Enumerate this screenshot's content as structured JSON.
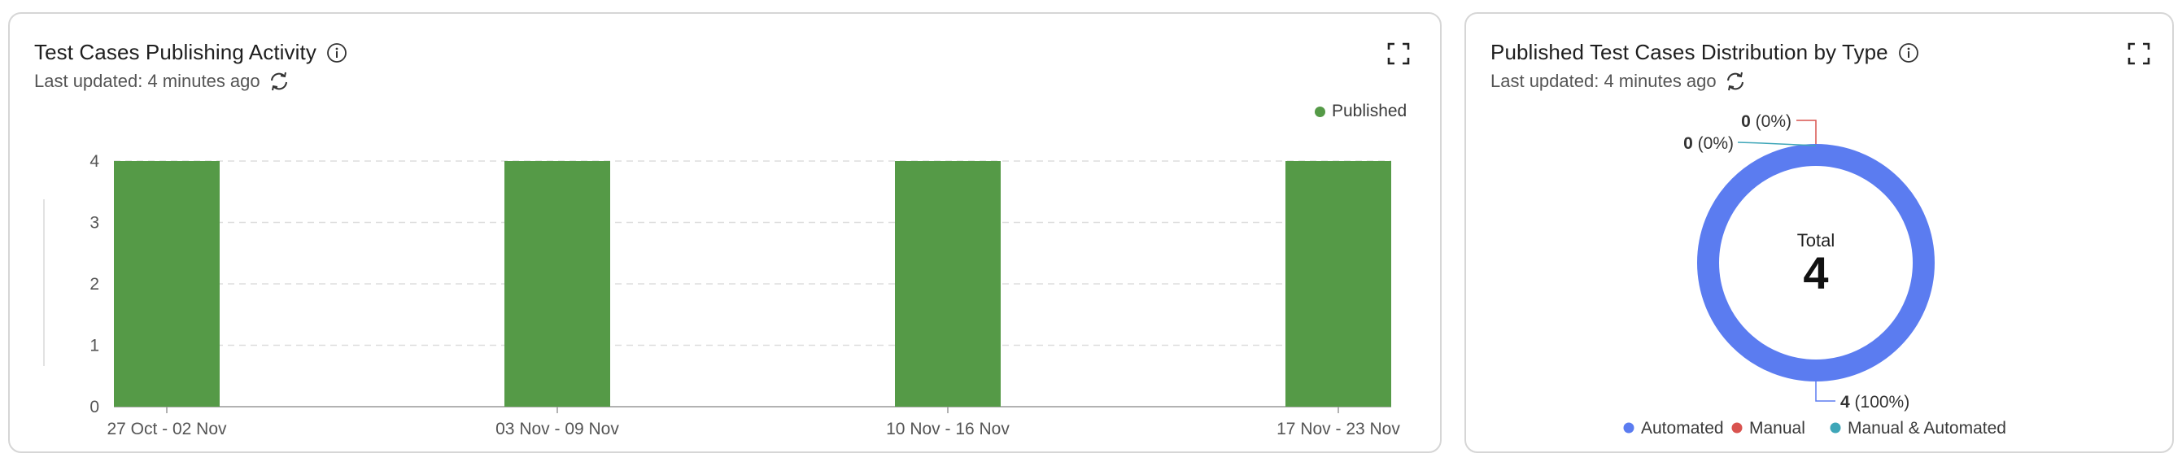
{
  "left_panel": {
    "title": "Test Cases Publishing Activity",
    "updated": "Last updated: 4 minutes ago",
    "legend": {
      "label": "Published",
      "color": "#559a47"
    },
    "icons": {
      "info": "info-icon",
      "refresh": "refresh-icon",
      "expand": "expand-icon"
    }
  },
  "right_panel": {
    "title": "Published Test Cases Distribution by Type",
    "updated": "Last updated: 4 minutes ago",
    "total_label": "Total",
    "total_value": "4",
    "labels": [
      {
        "value": "0",
        "pct": "(0%)",
        "color": "#d9534f"
      },
      {
        "value": "0",
        "pct": "(0%)",
        "color": "#3ea6b8"
      },
      {
        "value": "4",
        "pct": "(100%)",
        "color": "#5b7cf0"
      }
    ],
    "legend": [
      {
        "label": "Automated",
        "color": "#5b7cf0"
      },
      {
        "label": "Manual",
        "color": "#d9534f"
      },
      {
        "label": "Manual & Automated",
        "color": "#3ea6b8"
      }
    ]
  },
  "chart_data": [
    {
      "type": "bar",
      "categories": [
        "27 Oct - 02 Nov",
        "03 Nov - 09 Nov",
        "10 Nov - 16 Nov",
        "17 Nov - 23 Nov"
      ],
      "series": [
        {
          "name": "Published",
          "values": [
            4,
            4,
            4,
            4
          ],
          "color": "#559a47"
        }
      ],
      "yticks": [
        "0",
        "1",
        "2",
        "3",
        "4"
      ],
      "ylim": [
        0,
        4
      ],
      "grid": true,
      "legend_position": "top-right"
    },
    {
      "type": "pie",
      "categories": [
        "Automated",
        "Manual",
        "Manual & Automated"
      ],
      "values": [
        4,
        0,
        0
      ],
      "percent": [
        "100%",
        "0%",
        "0%"
      ],
      "colors": [
        "#5b7cf0",
        "#d9534f",
        "#3ea6b8"
      ]
    }
  ]
}
